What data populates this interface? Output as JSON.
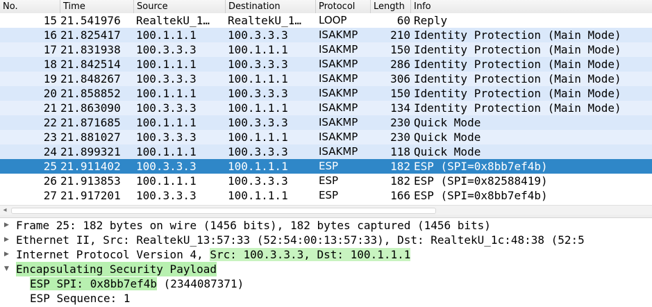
{
  "columns": {
    "no": "No.",
    "time": "Time",
    "source": "Source",
    "destination": "Destination",
    "protocol": "Protocol",
    "length": "Length",
    "info": "Info"
  },
  "packets": [
    {
      "no": "15",
      "time": "21.541976",
      "source": "RealtekU_1…",
      "destination": "RealtekU_1…",
      "protocol": "LOOP",
      "length": "60",
      "info": "Reply"
    },
    {
      "no": "16",
      "time": "21.825417",
      "source": "100.1.1.1",
      "destination": "100.3.3.3",
      "protocol": "ISAKMP",
      "length": "210",
      "info": "Identity Protection (Main Mode)"
    },
    {
      "no": "17",
      "time": "21.831938",
      "source": "100.3.3.3",
      "destination": "100.1.1.1",
      "protocol": "ISAKMP",
      "length": "150",
      "info": "Identity Protection (Main Mode)"
    },
    {
      "no": "18",
      "time": "21.842514",
      "source": "100.1.1.1",
      "destination": "100.3.3.3",
      "protocol": "ISAKMP",
      "length": "286",
      "info": "Identity Protection (Main Mode)"
    },
    {
      "no": "19",
      "time": "21.848267",
      "source": "100.3.3.3",
      "destination": "100.1.1.1",
      "protocol": "ISAKMP",
      "length": "306",
      "info": "Identity Protection (Main Mode)"
    },
    {
      "no": "20",
      "time": "21.858852",
      "source": "100.1.1.1",
      "destination": "100.3.3.3",
      "protocol": "ISAKMP",
      "length": "150",
      "info": "Identity Protection (Main Mode)"
    },
    {
      "no": "21",
      "time": "21.863090",
      "source": "100.3.3.3",
      "destination": "100.1.1.1",
      "protocol": "ISAKMP",
      "length": "134",
      "info": "Identity Protection (Main Mode)"
    },
    {
      "no": "22",
      "time": "21.871685",
      "source": "100.1.1.1",
      "destination": "100.3.3.3",
      "protocol": "ISAKMP",
      "length": "230",
      "info": "Quick Mode"
    },
    {
      "no": "23",
      "time": "21.881027",
      "source": "100.3.3.3",
      "destination": "100.1.1.1",
      "protocol": "ISAKMP",
      "length": "230",
      "info": "Quick Mode"
    },
    {
      "no": "24",
      "time": "21.899321",
      "source": "100.1.1.1",
      "destination": "100.3.3.3",
      "protocol": "ISAKMP",
      "length": "118",
      "info": "Quick Mode"
    },
    {
      "no": "25",
      "time": "21.911402",
      "source": "100.3.3.3",
      "destination": "100.1.1.1",
      "protocol": "ESP",
      "length": "182",
      "info": "ESP (SPI=0x8bb7ef4b)"
    },
    {
      "no": "26",
      "time": "21.913853",
      "source": "100.1.1.1",
      "destination": "100.3.3.3",
      "protocol": "ESP",
      "length": "182",
      "info": "ESP (SPI=0x82588419)"
    },
    {
      "no": "27",
      "time": "21.917201",
      "source": "100.3.3.3",
      "destination": "100.1.1.1",
      "protocol": "ESP",
      "length": "166",
      "info": "ESP (SPI=0x8bb7ef4b)"
    }
  ],
  "selected_packet": "25",
  "details": {
    "frame": "Frame 25: 182 bytes on wire (1456 bits), 182 bytes captured (1456 bits)",
    "ethernet": "Ethernet II, Src: RealtekU_13:57:33 (52:54:00:13:57:33), Dst: RealtekU_1c:48:38 (52:5",
    "ip_prefix": "Internet Protocol Version 4,",
    "ip_src": "Src: 100.3.3.3,",
    "ip_dst": "Dst: 100.1.1.1",
    "esp": "Encapsulating Security Payload",
    "esp_spi_hl": "ESP SPI: 0x8bb7ef4b",
    "esp_spi_rest": "(2344087371)",
    "esp_seq": "ESP Sequence: 1"
  },
  "colors": {
    "row_odd": "#dae8fa",
    "row_even": "#e6effc",
    "selected": "#2f87c8",
    "highlight_green": "#b8f0b0"
  },
  "icons": {
    "collapsed": "triangle-right",
    "expanded": "triangle-down",
    "scroll_left": "arrow-left"
  }
}
